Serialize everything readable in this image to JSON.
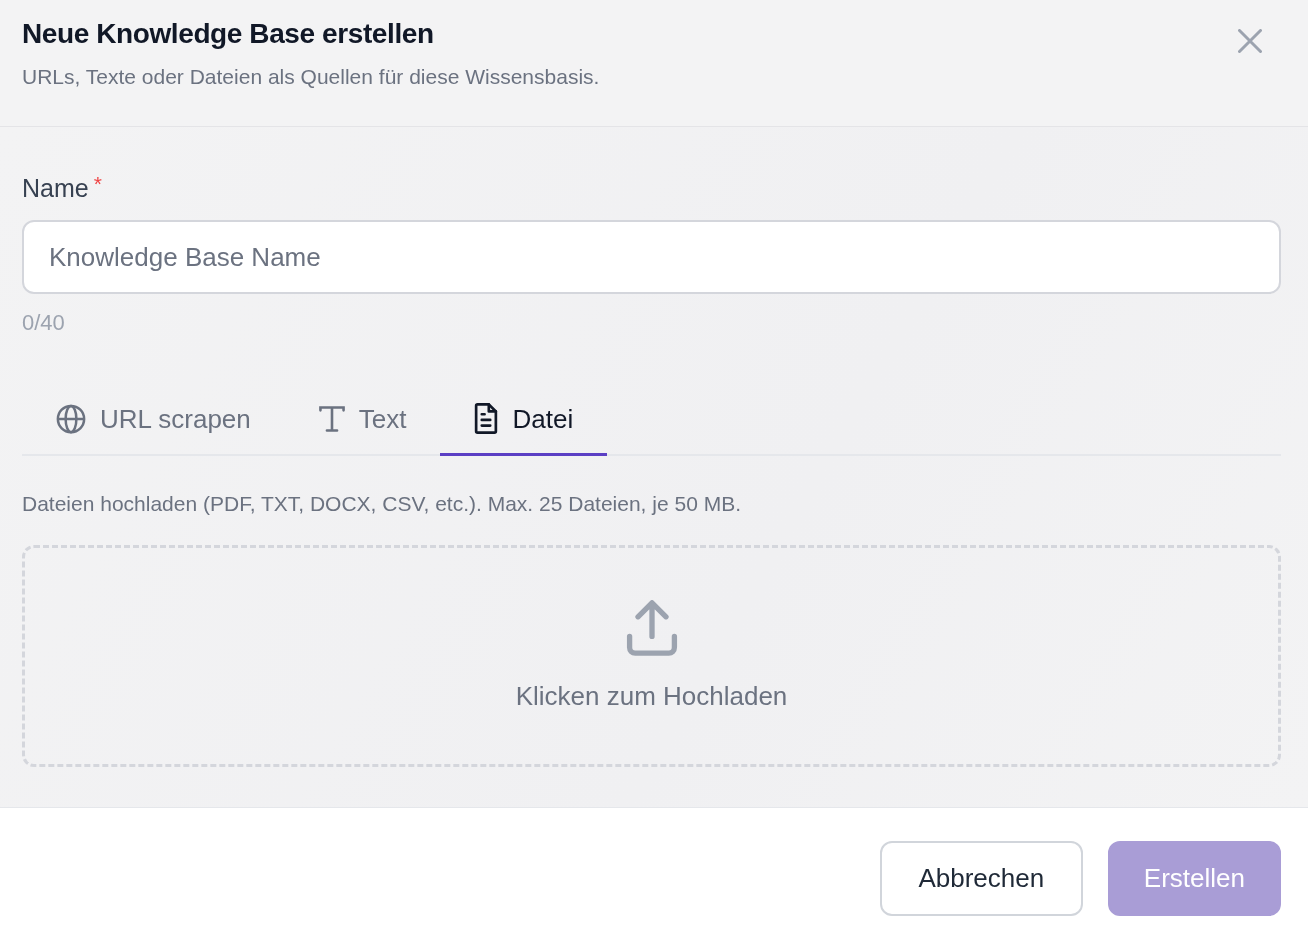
{
  "dialog": {
    "title": "Neue Knowledge Base erstellen",
    "subtitle": "URLs, Texte oder Dateien als Quellen für diese Wissensbasis."
  },
  "name_field": {
    "label": "Name",
    "required_mark": "*",
    "placeholder": "Knowledge Base Name",
    "counter": "0/40"
  },
  "source_tabs": [
    {
      "kind": "url",
      "label": "URL scrapen",
      "selected": false
    },
    {
      "kind": "text",
      "label": "Text",
      "selected": false
    },
    {
      "kind": "file",
      "label": "Datei",
      "selected": true
    }
  ],
  "upload": {
    "description": "Dateien hochladen (PDF, TXT, DOCX, CSV, etc.). Max. 25 Dateien, je 50 MB.",
    "dropzone_label": "Klicken zum Hochladen"
  },
  "buttons": [
    {
      "kind": "secondary",
      "label": "Abbrechen",
      "disabled": false
    },
    {
      "kind": "primary",
      "label": "Erstellen",
      "disabled": true
    }
  ]
}
